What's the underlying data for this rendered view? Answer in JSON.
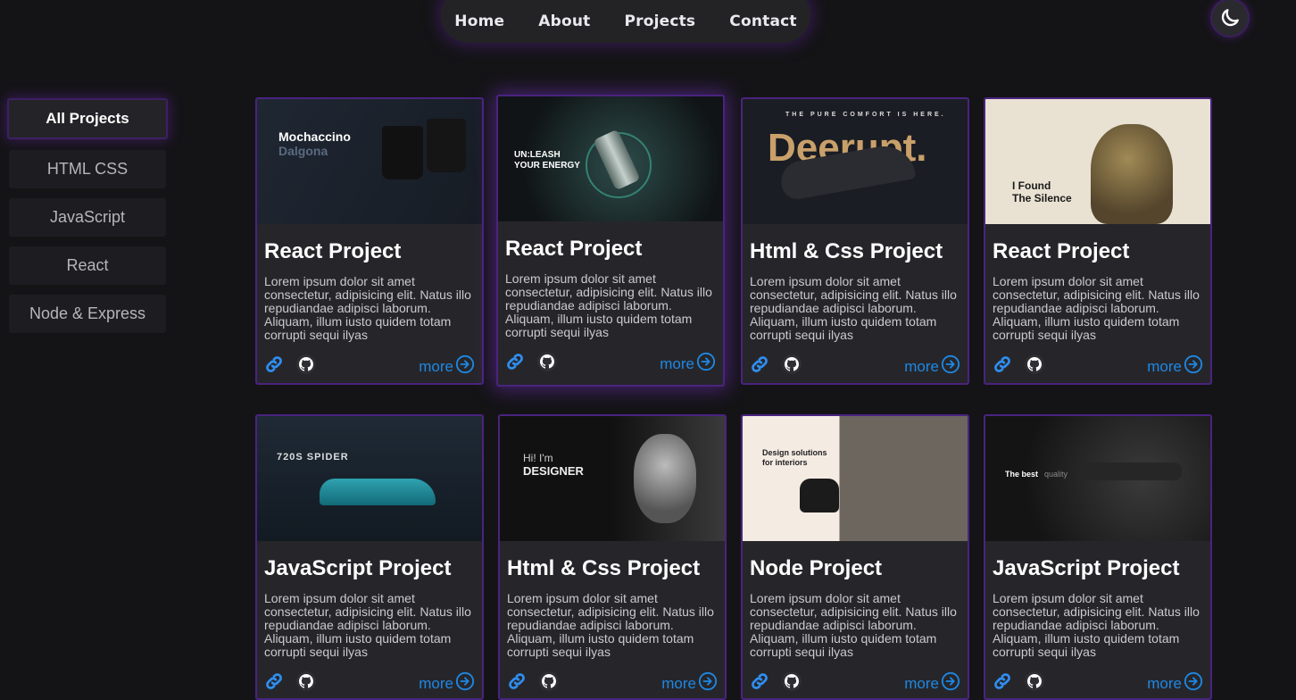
{
  "nav": {
    "items": [
      "Home",
      "About",
      "Projects",
      "Contact"
    ],
    "theme_toggle_icon": "moon-icon"
  },
  "filters": [
    "All Projects",
    "HTML CSS",
    "JavaScript",
    "React",
    "Node & Express"
  ],
  "active_filter": "All Projects",
  "cards": [
    {
      "title": "React Project",
      "thumb": {
        "headline": "Mochaccino",
        "sub": "Dalgona"
      }
    },
    {
      "title": "React Project",
      "thumb": {
        "headline": "UN:LEASH",
        "sub": "YOUR ENERGY"
      }
    },
    {
      "title": "Html & Css Project",
      "thumb": {
        "headline": "Deerupt.",
        "sub": "THE PURE COMFORT IS HERE."
      }
    },
    {
      "title": "React Project",
      "thumb": {
        "headline": "I Found",
        "sub": "The Silence"
      }
    },
    {
      "title": "JavaScript Project",
      "thumb": {
        "headline": "720S SPIDER",
        "sub": ""
      }
    },
    {
      "title": "Html & Css Project",
      "thumb": {
        "headline": "Hi! I'm",
        "sub": "DESIGNER"
      }
    },
    {
      "title": "Node Project",
      "thumb": {
        "headline": "Design solutions",
        "sub": "for interiors"
      }
    },
    {
      "title": "JavaScript Project",
      "thumb": {
        "headline": "The best",
        "sub": "quality"
      }
    }
  ],
  "card_description": "Lorem ipsum dolor sit amet consectetur, adipisicing elit. Natus illo repudiandae adipisci laborum. Aliquam, illum iusto quidem totam corrupti sequi ilyas",
  "more_label": "more",
  "colors": {
    "accent": "#1e88e5",
    "border": "#4a2380",
    "background": "#141416"
  }
}
